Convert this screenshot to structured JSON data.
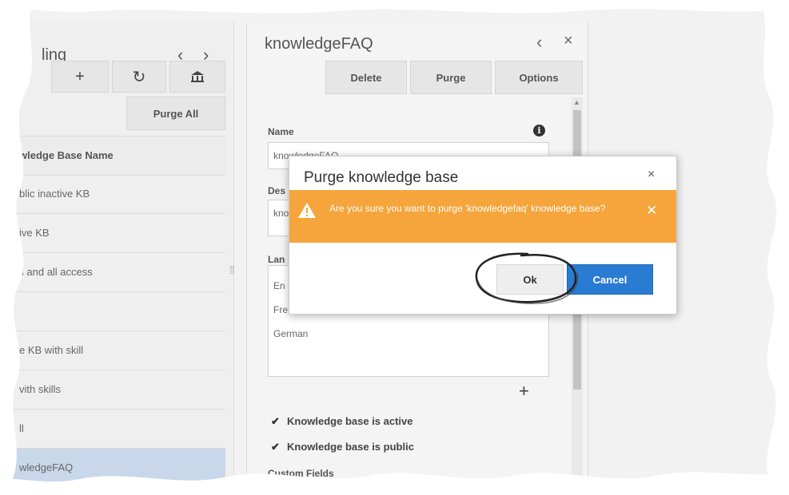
{
  "left_panel": {
    "title": "ling",
    "nav_prev": "‹",
    "nav_next": "›",
    "toolbar": {
      "add_label": "+",
      "refresh_label": "↻",
      "archive_label": "⌂",
      "purge_all_label": "Purge All"
    },
    "column_header": "wledge Base Name",
    "rows": [
      {
        "label": "blic inactive KB"
      },
      {
        "label": "ive KB"
      },
      {
        "label": "ll and all access"
      },
      {
        "label": ""
      },
      {
        "label": "e KB with skill"
      },
      {
        "label": "vith skills"
      },
      {
        "label": "ll"
      },
      {
        "label": "wledgeFAQ",
        "selected": true
      }
    ]
  },
  "splitter_glyph": "⁞⁞",
  "right_panel": {
    "title": "knowledgeFAQ",
    "back_glyph": "‹",
    "close_glyph": "×",
    "actions": {
      "delete_label": "Delete",
      "purge_label": "Purge",
      "options_label": "Options"
    },
    "form": {
      "name_label": "Name",
      "name_value": "knowledgeFAQ",
      "description_label": "Des",
      "description_value": "kno",
      "languages_label": "Lan",
      "languages": [
        "En",
        "Fre",
        "German"
      ],
      "add_language": "+",
      "checkbox_active_label": "Knowledge base is active",
      "checkbox_public_label": "Knowledge base is public",
      "checkbox_mark": "✔",
      "custom_fields_label": "Custom Fields"
    }
  },
  "dialog": {
    "title": "Purge knowledge base",
    "close_glyph": "×",
    "warning_text": "Are you sure you want to purge 'knowledgefaq' knowledge base?",
    "warning_close": "✕",
    "ok_label": "Ok",
    "cancel_label": "Cancel"
  },
  "colors": {
    "warning": "#f5a53b",
    "primary": "#2a7bd2",
    "selected_row": "#c9d7ea"
  }
}
